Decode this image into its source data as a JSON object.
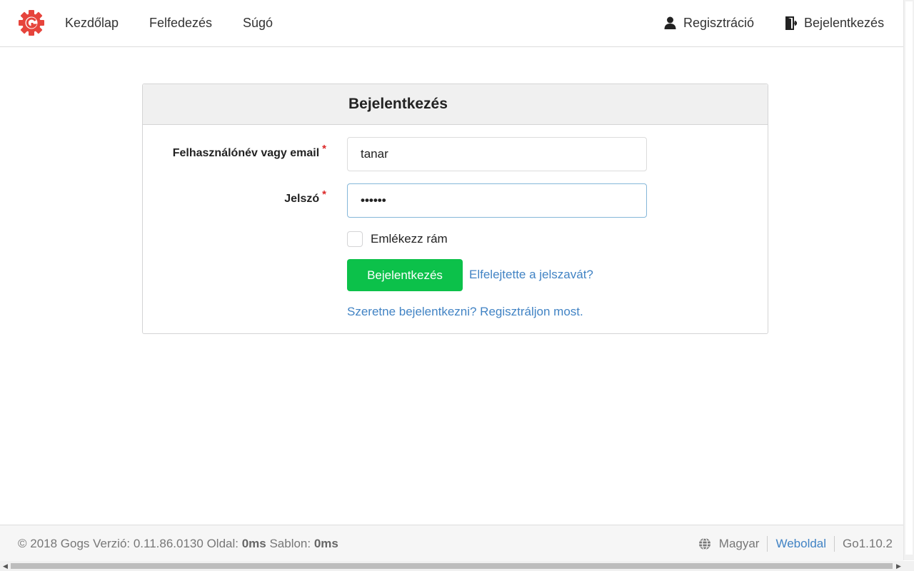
{
  "header": {
    "logo_icon": "gogs-logo-icon",
    "nav": [
      "Kezdőlap",
      "Felfedezés",
      "Súgó"
    ],
    "register": "Regisztráció",
    "signin": "Bejelentkezés"
  },
  "login": {
    "title": "Bejelentkezés",
    "username_label": "Felhasználónév vagy email",
    "required_mark": "*",
    "username_value": "tanar",
    "password_label": "Jelszó",
    "password_value": "••••••",
    "remember_label": "Emlékezz rám",
    "submit_label": "Bejelentkezés",
    "forgot_link": "Elfelejtette a jelszavát?",
    "register_link": "Szeretne bejelentkezni? Regisztráljon most."
  },
  "footer": {
    "copyright_prefix": "© 2018 Gogs Verzió: 0.11.86.0130 Oldal: ",
    "page_time": "0ms",
    "template_prefix": " Sablon: ",
    "template_time": "0ms",
    "language": "Magyar",
    "website": "Weboldal",
    "go_version": "Go1.10.2"
  },
  "colors": {
    "accent_green": "#0cc14a",
    "link_blue": "#4183c4",
    "required_red": "#db2828"
  }
}
